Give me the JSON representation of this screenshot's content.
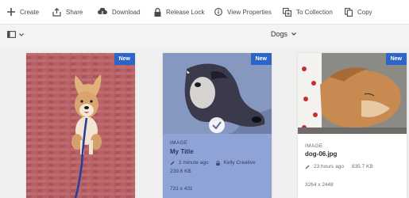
{
  "toolbar": {
    "items": [
      {
        "icon": "plus-icon",
        "label": "Create"
      },
      {
        "icon": "share-icon",
        "label": "Share"
      },
      {
        "icon": "download-icon",
        "label": "Download"
      },
      {
        "icon": "lock-icon",
        "label": "Release Lock"
      },
      {
        "icon": "info-icon",
        "label": "View Properties"
      },
      {
        "icon": "collection-icon",
        "label": "To Collection"
      },
      {
        "icon": "copy-icon",
        "label": "Copy"
      }
    ]
  },
  "subbar": {
    "rail_icon": "sidebar-toggle-icon",
    "folder_title": "Dogs"
  },
  "cards": [
    {
      "badge": "New",
      "selected": false
    },
    {
      "badge": "New",
      "selected": true,
      "type": "IMAGE",
      "title": "My Title",
      "modified": "1 minute ago",
      "locked_by": "Kelly Creative",
      "size": "239.6 KB",
      "dimensions": "731 x 431"
    },
    {
      "badge": "New",
      "selected": false,
      "type": "IMAGE",
      "title": "dog-06.jpg",
      "modified": "23 hours ago",
      "size": "835.7 KB",
      "dimensions": "3264 x 2448"
    }
  ],
  "colors": {
    "accent": "#2d64c8",
    "selected_overlay": "#8fa3d6"
  }
}
